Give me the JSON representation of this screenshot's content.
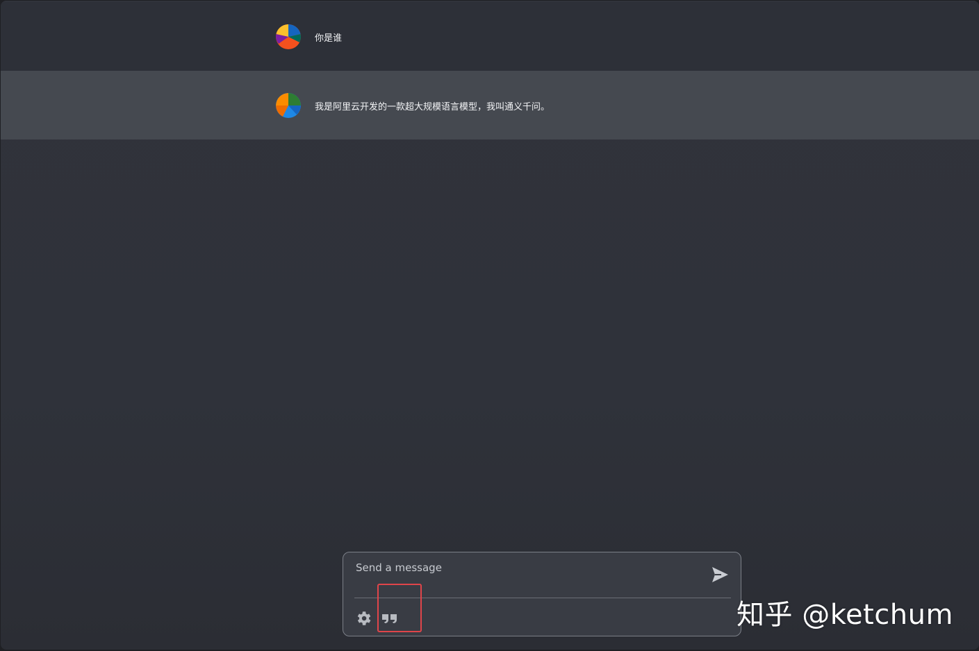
{
  "conversation": {
    "messages": [
      {
        "role": "user",
        "text": "你是谁"
      },
      {
        "role": "assistant",
        "text": "我是阿里云开发的一款超大规模语言模型，我叫通义千问。"
      }
    ]
  },
  "composer": {
    "placeholder": "Send a message",
    "value": "",
    "icons": {
      "send": "send-icon",
      "settings": "gear-icon",
      "quote": "quote-icon"
    }
  },
  "annotation": {
    "color": "#e0454a"
  },
  "watermark": {
    "text": "知乎 @ketchum"
  },
  "colors": {
    "background": "#30333b",
    "user_row": "#2d3038",
    "assistant_row": "#454950",
    "composer_border": "#7c8088"
  }
}
